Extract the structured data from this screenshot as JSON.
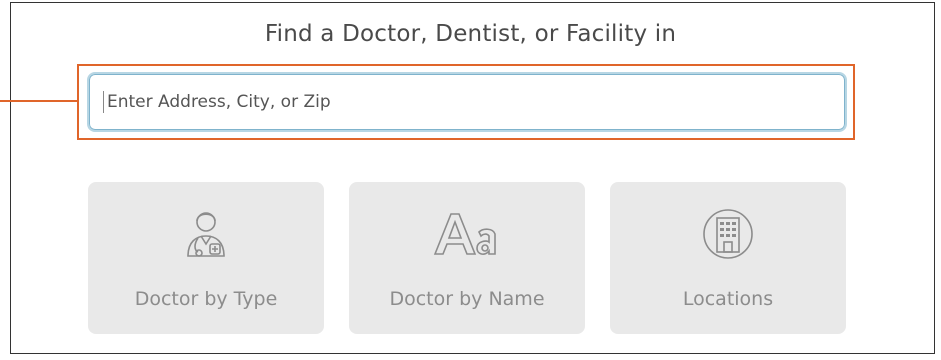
{
  "header": {
    "title": "Find a Doctor, Dentist, or Facility in"
  },
  "search": {
    "placeholder": "Enter Address, City, or Zip",
    "value": ""
  },
  "cards": [
    {
      "label": "Doctor by Type",
      "icon": "doctor-icon"
    },
    {
      "label": "Doctor by Name",
      "icon": "letters-aa-icon"
    },
    {
      "label": "Locations",
      "icon": "building-icon"
    }
  ],
  "colors": {
    "highlight": "#e0652a",
    "card_bg": "#e9e9e9",
    "card_text": "#8c8c8c",
    "input_border": "#b7d6e4"
  }
}
